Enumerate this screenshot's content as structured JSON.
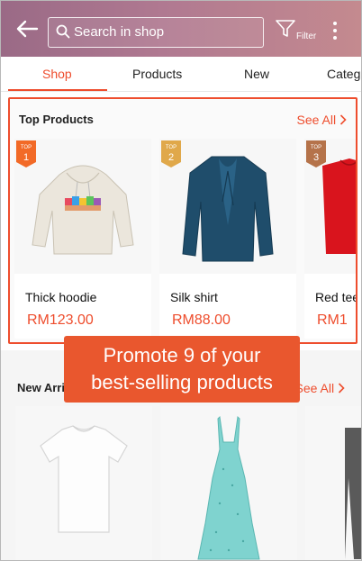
{
  "header": {
    "search_placeholder": "Search in shop",
    "filter_label": "Filter"
  },
  "tabs": [
    "Shop",
    "Products",
    "New",
    "Categ"
  ],
  "top_products": {
    "title": "Top Products",
    "see_all": "See All",
    "items": [
      {
        "badge": "TOP",
        "rank": "1",
        "name": "Thick hoodie",
        "price": "RM123.00"
      },
      {
        "badge": "TOP",
        "rank": "2",
        "name": "Silk shirt",
        "price": "RM88.00"
      },
      {
        "badge": "TOP",
        "rank": "3",
        "name": "Red tee",
        "price": "RM1"
      }
    ]
  },
  "promo": {
    "line1": "Promote 9 of your",
    "line2": "best-selling products"
  },
  "new_arrivals": {
    "title": "New Arri",
    "see_all": "See All"
  },
  "colors": {
    "accent": "#ee4d2d",
    "header_start": "#9a6a86",
    "header_end": "#c48a8f"
  }
}
